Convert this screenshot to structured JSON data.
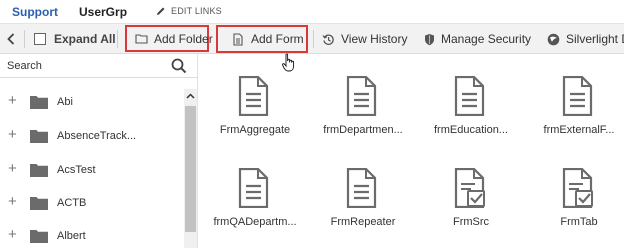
{
  "topnav": {
    "support": "Support",
    "usergrp": "UserGrp",
    "edit_links": "EDIT LINKS"
  },
  "toolbar": {
    "expand_all": "Expand All",
    "add_folder": "Add Folder",
    "add_form": "Add Form",
    "view_history": "View History",
    "manage_security": "Manage Security",
    "silverlight": "Silverlight D"
  },
  "sidebar": {
    "search_placeholder": "Search",
    "items": [
      {
        "label": "Abi"
      },
      {
        "label": "AbsenceTrack..."
      },
      {
        "label": "AcsTest"
      },
      {
        "label": "ACTB"
      },
      {
        "label": "Albert"
      }
    ]
  },
  "forms": [
    {
      "label": "FrmAggregate",
      "icon": "form-document-icon"
    },
    {
      "label": "frmDepartmen...",
      "icon": "form-document-icon"
    },
    {
      "label": "frmEducation...",
      "icon": "form-document-icon"
    },
    {
      "label": "frmExternalF...",
      "icon": "form-document-icon"
    },
    {
      "label": "frmQADepartm...",
      "icon": "form-document-icon"
    },
    {
      "label": "FrmRepeater",
      "icon": "form-document-icon"
    },
    {
      "label": "FrmSrc",
      "icon": "form-checked-document-icon"
    },
    {
      "label": "FrmTab",
      "icon": "form-checked-document-icon"
    }
  ],
  "colors": {
    "highlight_border": "#d9393a",
    "nav_link": "#2a5fb0",
    "toolbar_bg": "#f2f2f2",
    "folder_fill": "#6b6b6b"
  }
}
